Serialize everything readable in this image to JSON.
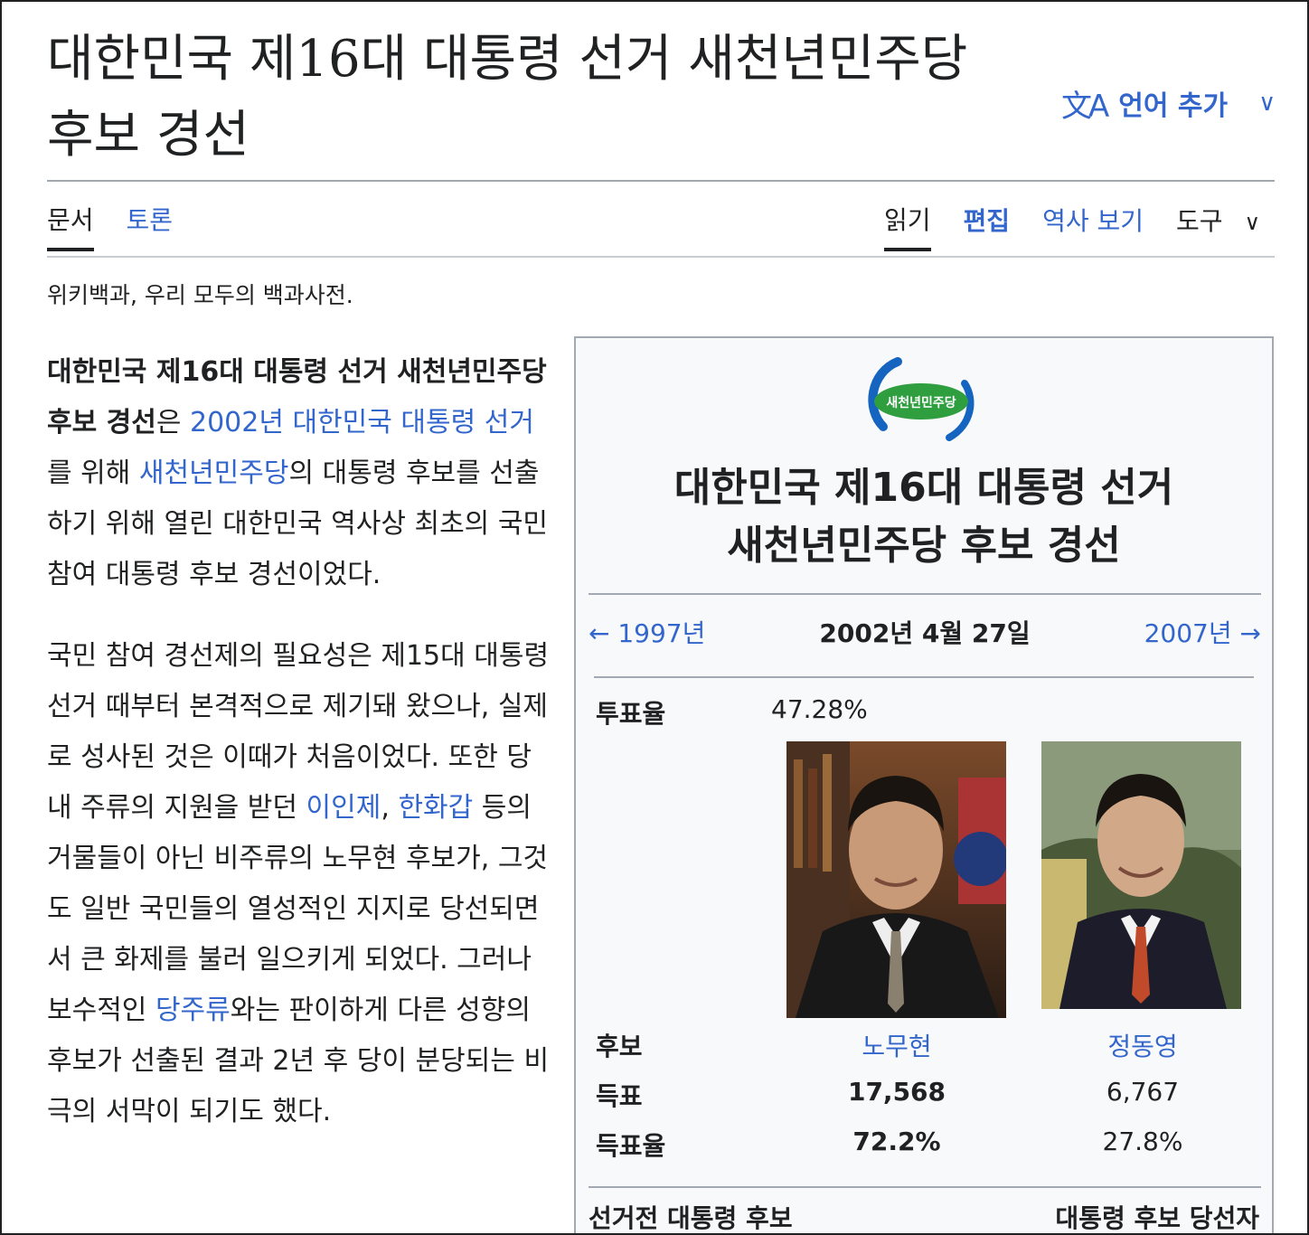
{
  "page": {
    "title": "대한민국 제16대 대통령 선거 새천년민주당 후보 경선",
    "language_button": "언어 추가",
    "tagline": "위키백과, 우리 모두의 백과사전."
  },
  "tabs": {
    "left": [
      {
        "label": "문서"
      },
      {
        "label": "토론"
      }
    ],
    "right": [
      {
        "label": "읽기"
      },
      {
        "label": "편집"
      },
      {
        "label": "역사 보기"
      },
      {
        "label": "도구"
      }
    ]
  },
  "article": {
    "p1": [
      {
        "text": "대한민국 제16대 대통령 선거 새천년민주당 후보 경선",
        "type": "bold"
      },
      {
        "text": "은 ",
        "type": "text"
      },
      {
        "text": "2002년 대한민국 대통령 선거",
        "type": "link"
      },
      {
        "text": "를 위해 ",
        "type": "text"
      },
      {
        "text": "새천년민주당",
        "type": "link"
      },
      {
        "text": "의 대통령 후보를 선출하기 위해 열린 대한민국 역사상 최초의 국민 참여 대통령 후보 경선이었다.",
        "type": "text"
      }
    ],
    "p2": [
      {
        "text": "국민 참여 경선제의 필요성은 제15대 대통령 선거 때부터 본격적으로 제기돼 왔으나, 실제로 성사된 것은 이때가 처음이었다. 또한 당내 주류의 지원을 받던 ",
        "type": "text"
      },
      {
        "text": "이인제",
        "type": "link"
      },
      {
        "text": ", ",
        "type": "text"
      },
      {
        "text": "한화갑",
        "type": "link"
      },
      {
        "text": " 등의 거물들이 아닌 비주류의 노무현 후보가, 그것도 일반 국민들의 열성적인 지지로 당선되면서 큰 화제를 불러 일으키게 되었다. 그러나 보수적인 ",
        "type": "text"
      },
      {
        "text": "당주류",
        "type": "link"
      },
      {
        "text": "와는 판이하게 다른 성향의 후보가 선출된 결과 2년 후 당이 분당되는 비극의 서막이 되기도 했다.",
        "type": "text"
      }
    ]
  },
  "infobox": {
    "logo_text": "새천년민주당",
    "title_line1": "대한민국 제16대 대통령 선거",
    "title_line2": "새천년민주당 후보 경선",
    "prev": "← 1997년",
    "date": "2002년 4월 27일",
    "next": "2007년 →",
    "turnout_label": "투표율",
    "turnout_value": "47.28%",
    "candidate_label": "후보",
    "votes_label": "득표",
    "share_label": "득표율",
    "candidates": [
      {
        "name": "노무현",
        "votes": "17,568",
        "share": "72.2%"
      },
      {
        "name": "정동영",
        "votes": "6,767",
        "share": "27.8%"
      }
    ],
    "footer_left": "선거전 대통령 후보",
    "footer_right": "대통령 후보 당선자"
  },
  "colors": {
    "link": "#3366cc",
    "text": "#202122",
    "infobox_bg": "#f8f9fa",
    "border": "#a2a9b1",
    "logo_blue": "#1565c0",
    "logo_green": "#2e9e3f"
  }
}
